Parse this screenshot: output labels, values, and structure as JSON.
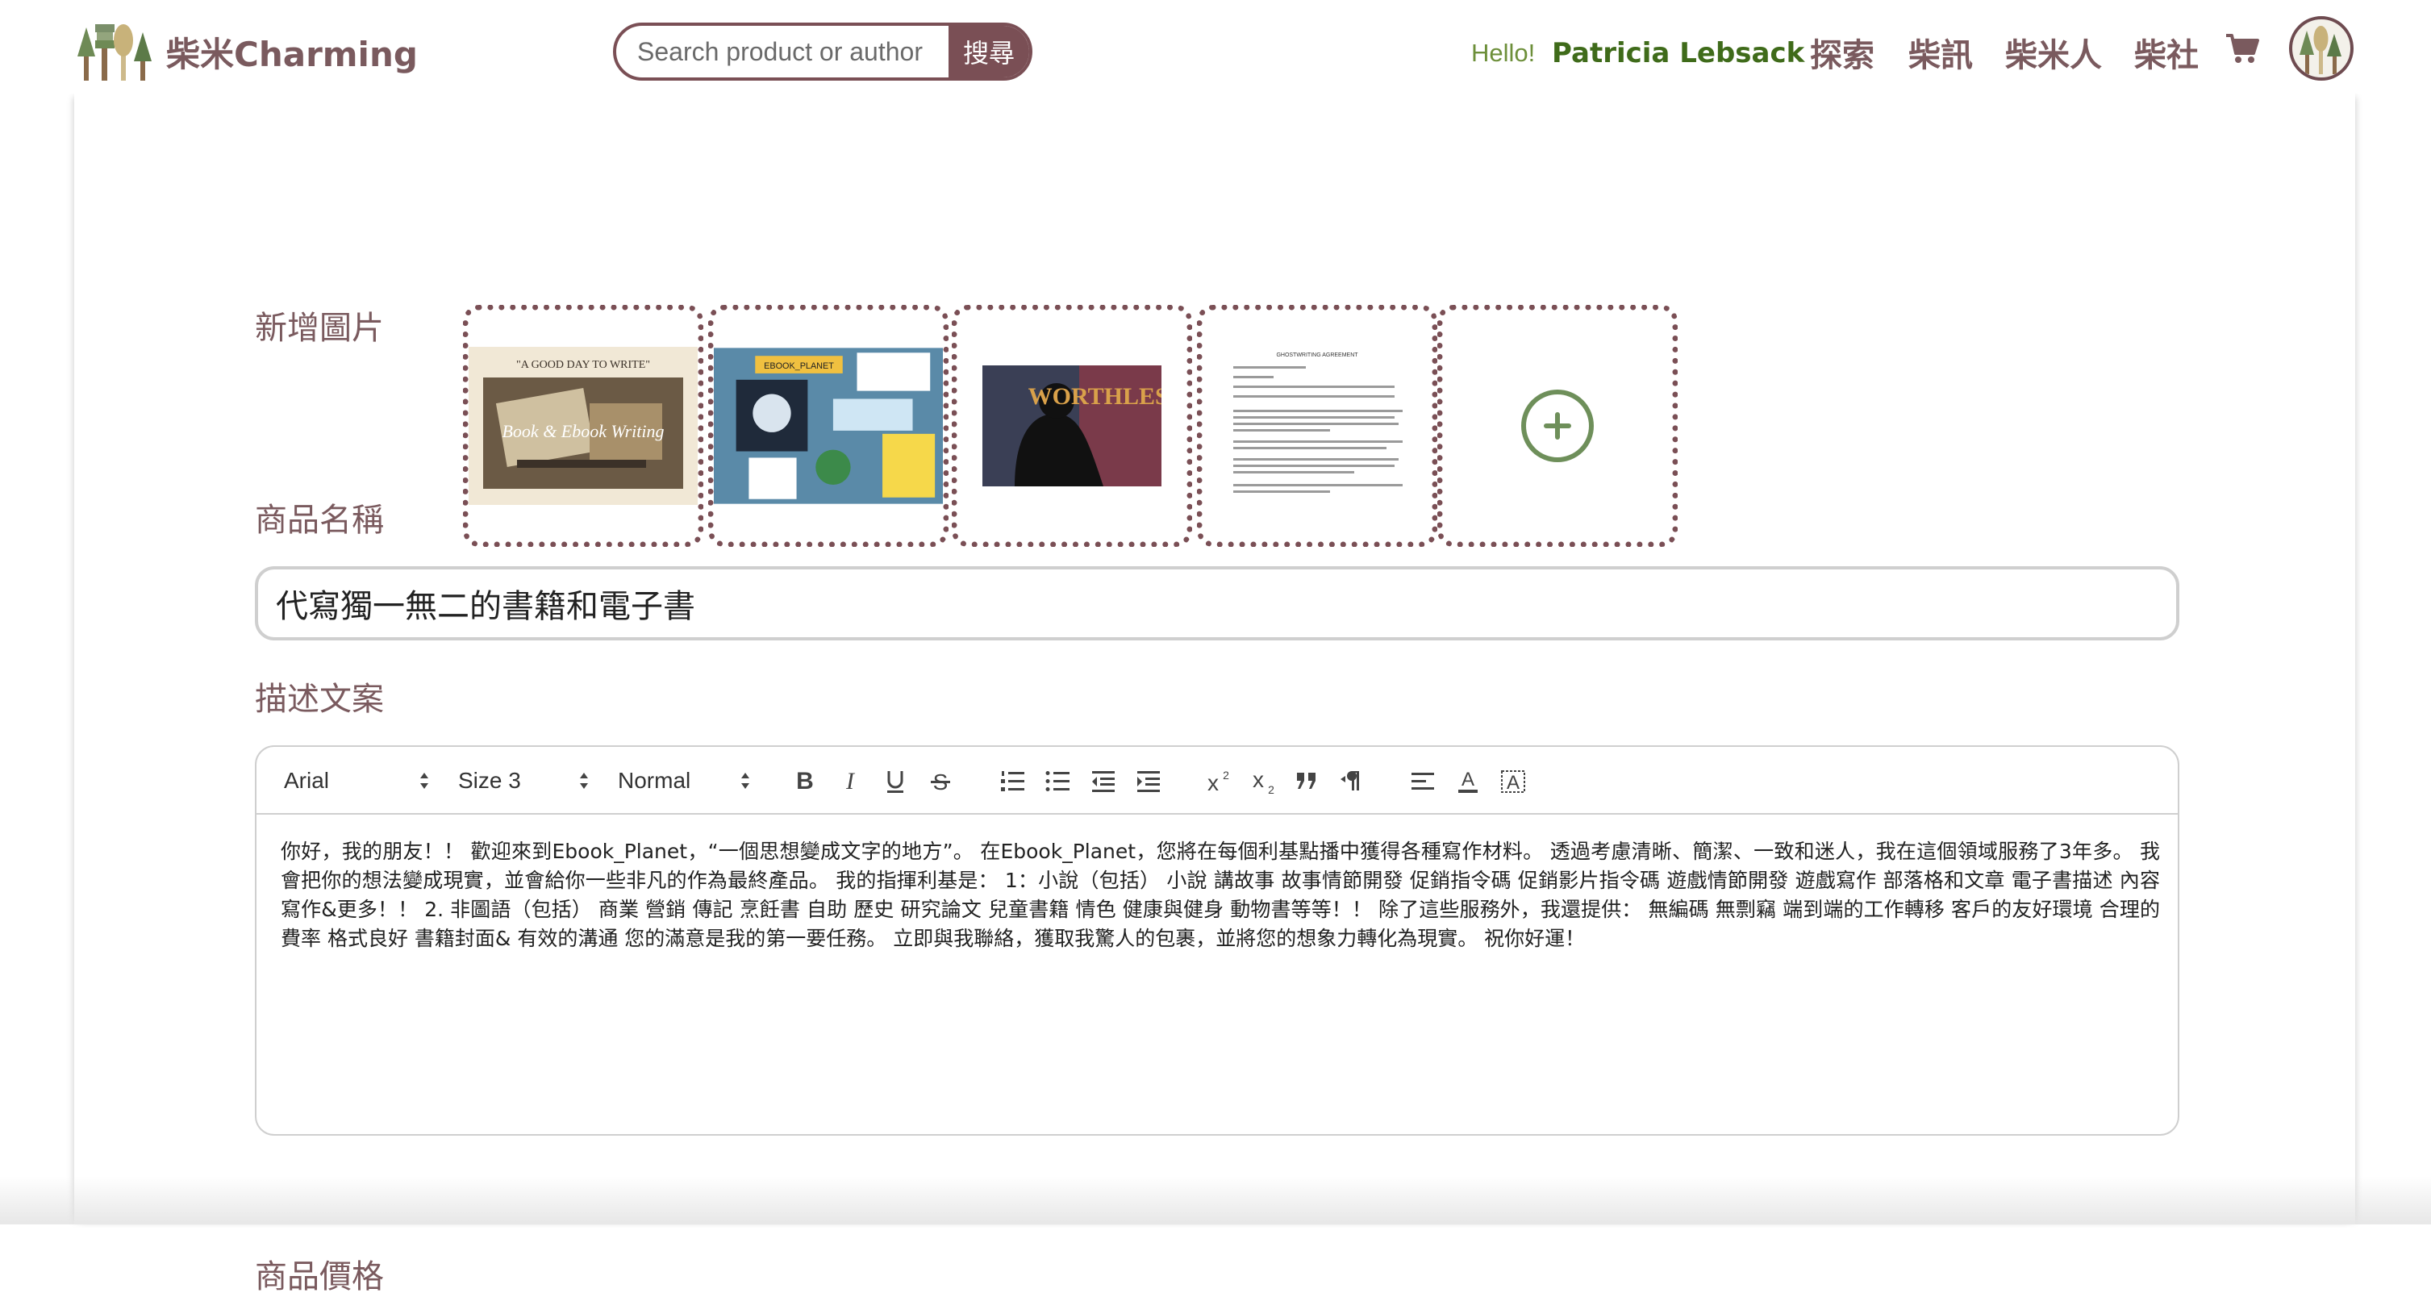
{
  "header": {
    "brand": "柴米Charming",
    "search_placeholder": "Search product or author",
    "search_button": "搜尋",
    "greeting": "Hello!",
    "user_name": "Patricia Lebsack",
    "nav": [
      "探索",
      "柴訊",
      "柴米人",
      "柴社"
    ]
  },
  "form": {
    "images_label": "新增圖片",
    "thumbnails": [
      {
        "title": "\"A GOOD DAY TO WRITE\"",
        "caption": "Book & Ebook Writing"
      },
      {
        "title": "EBOOK_PLANET",
        "caption": ""
      },
      {
        "title": "WORTHLESS",
        "caption": ""
      },
      {
        "title": "GHOSTWRITING AGREEMENT",
        "caption": ""
      }
    ],
    "name_label": "商品名稱",
    "name_value": "代寫獨一無二的書籍和電子書",
    "desc_label": "描述文案",
    "price_label": "商品價格"
  },
  "editor": {
    "font": "Arial",
    "size": "Size 3",
    "style": "Normal",
    "content": "你好，我的朋友！！ 歡迎來到Ebook_Planet，“一個思想變成文字的地方”。 在Ebook_Planet，您將在每個利基點播中獲得各種寫作材料。 透過考慮清晰、簡潔、一致和迷人，我在這個領域服務了3年多。 我會把你的想法變成現實，並會給你一些非凡的作為最終產品。 我的指揮利基是： 1：小說（包括） 小說 講故事 故事情節開發 促銷指令碼 促銷影片指令碼 遊戲情節開發 遊戲寫作 部落格和文章 電子書描述 內容寫作&更多！！ 2. 非圖語（包括） 商業 營銷 傳記 烹飪書 自助 歷史 研究論文 兒童書籍 情色 健康與健身 動物書等等！！ 除了這些服務外，我還提供： 無編碼 無剽竊 端到端的工作轉移 客戶的友好環境 合理的費率 格式良好 書籍封面& 有效的溝通 您的滿意是我的第一要任務。 立即與我聯絡，獲取我驚人的包裹，並將您的想象力轉化為現實。 祝你好運！"
  },
  "colors": {
    "brand": "#7a4f55",
    "greeting": "#6d8f3a",
    "user": "#3f6b1a",
    "add_icon": "#6e8f5a"
  }
}
